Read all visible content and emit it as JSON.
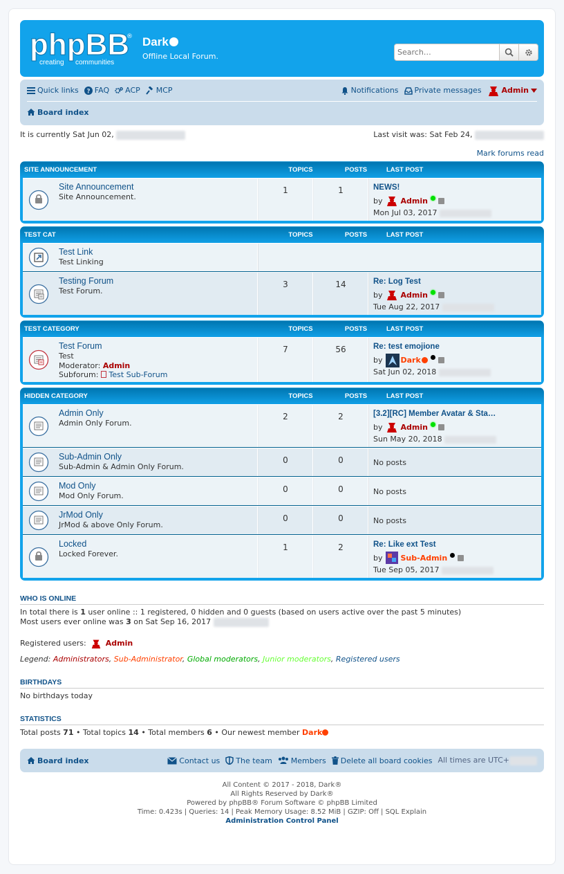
{
  "header": {
    "logo_text": "phpBB",
    "logo_sub1": "creating",
    "logo_sub2": "communities",
    "site_title": "Dark",
    "site_desc": "Offline Local Forum.",
    "search_placeholder": "Search…"
  },
  "navbar": {
    "quick_links": "Quick links",
    "faq": "FAQ",
    "acp": "ACP",
    "mcp": "MCP",
    "notifications": "Notifications",
    "private_messages": "Private messages",
    "user": "Admin",
    "board_index": "Board index"
  },
  "info": {
    "current_time": "It is currently Sat Jun 02,",
    "last_visit": "Last visit was: Sat Feb 24,",
    "mark_read": "Mark forums read"
  },
  "columns": {
    "topics": "TOPICS",
    "posts": "POSTS",
    "last_post": "LAST POST"
  },
  "categories": [
    {
      "name": "SITE ANNOUNCEMENT",
      "forums": [
        {
          "title": "Site Announcement",
          "desc": "Site Announcement.",
          "icon": "locked",
          "topics": "1",
          "posts": "1",
          "last": {
            "title": "NEWS!",
            "by": "by",
            "user": "Admin",
            "ucls": "u-admin",
            "avatar": "admin",
            "dot": "green",
            "date": "Mon Jul 03, 2017"
          }
        }
      ]
    },
    {
      "name": "TEST CAT",
      "forums": [
        {
          "title": "Test Link",
          "desc": "Test Linking",
          "icon": "link",
          "topics": "",
          "posts": "",
          "last": null,
          "nolast": true
        },
        {
          "title": "Testing Forum",
          "desc": "Test Forum.",
          "icon": "subforum",
          "topics": "3",
          "posts": "14",
          "last": {
            "title": "Re: Log Test",
            "by": "by",
            "user": "Admin",
            "ucls": "u-admin",
            "avatar": "admin",
            "dot": "green",
            "date": "Tue Aug 22, 2017"
          }
        }
      ]
    },
    {
      "name": "TEST CATEGORY",
      "forums": [
        {
          "title": "Test Forum",
          "desc": "Test",
          "icon": "unread-subforum",
          "topics": "7",
          "posts": "56",
          "moderator_label": "Moderator:",
          "moderator": "Admin",
          "subforum_label": "Subforum:",
          "subforum": "Test Sub-Forum",
          "last": {
            "title": "Re: test emojione",
            "by": "by",
            "user": "Dark",
            "ucls": "u-dark",
            "avatar": "dark",
            "dot": "black",
            "date": "Sat Jun 02, 2018"
          }
        }
      ]
    },
    {
      "name": "HIDDEN CATEGORY",
      "forums": [
        {
          "title": "Admin Only",
          "desc": "Admin Only Forum.",
          "icon": "read",
          "topics": "2",
          "posts": "2",
          "last": {
            "title": "[3.2][RC] Member Avatar & Sta…",
            "by": "by",
            "user": "Admin",
            "ucls": "u-admin",
            "avatar": "admin",
            "dot": "green",
            "date": "Sun May 20, 2018"
          }
        },
        {
          "title": "Sub-Admin Only",
          "desc": "Sub-Admin & Admin Only Forum.",
          "icon": "read",
          "topics": "0",
          "posts": "0",
          "last": null,
          "noposts": "No posts"
        },
        {
          "title": "Mod Only",
          "desc": "Mod Only Forum.",
          "icon": "read",
          "topics": "0",
          "posts": "0",
          "last": null,
          "noposts": "No posts"
        },
        {
          "title": "JrMod Only",
          "desc": "JrMod & above Only Forum.",
          "icon": "read",
          "topics": "0",
          "posts": "0",
          "last": null,
          "noposts": "No posts"
        },
        {
          "title": "Locked",
          "desc": "Locked Forever.",
          "icon": "locked",
          "topics": "1",
          "posts": "2",
          "last": {
            "title": "Re: Like ext Test",
            "by": "by",
            "user": "Sub-Admin",
            "ucls": "u-sub",
            "avatar": "sub",
            "dot": "black",
            "date": "Tue Sep 05, 2017"
          }
        }
      ]
    }
  ],
  "online": {
    "heading": "WHO IS ONLINE",
    "line1_a": "In total there is ",
    "line1_count": "1",
    "line1_b": " user online :: 1 registered, 0 hidden and 0 guests (based on users active over the past 5 minutes)",
    "line2_a": "Most users ever online was ",
    "line2_count": "3",
    "line2_b": " on Sat Sep 16, 2017",
    "registered_label": "Registered users:",
    "registered_user": "Admin",
    "legend_label": "Legend:",
    "legend": [
      "Administrators",
      "Sub-Administrator",
      "Global moderators",
      "Junior moderators",
      "Registered users"
    ]
  },
  "birthdays": {
    "heading": "BIRTHDAYS",
    "text": "No birthdays today"
  },
  "statistics": {
    "heading": "STATISTICS",
    "posts_label": "Total posts ",
    "posts": "71",
    "topics_label": " • Total topics ",
    "topics": "14",
    "members_label": " • Total members ",
    "members": "6",
    "newest_label": " • Our newest member ",
    "newest": "Dark"
  },
  "footer": {
    "board_index": "Board index",
    "contact": "Contact us",
    "team": "The team",
    "members": "Members",
    "delete_cookies": "Delete all board cookies",
    "timezone": "All times are UTC+",
    "copy1": "All Content © 2017 - 2018, Dark®",
    "copy2": "All Rights Reserved by Dark",
    "copy3": "Powered by phpBB® Forum Software © phpBB Limited",
    "copy4": "Time: 0.423s | Queries: 14 | Peak Memory Usage: 8.52 MiB | GZIP: Off | SQL Explain",
    "acp_link": "Administration Control Panel"
  },
  "colors": {
    "header": "#12a3eb",
    "navbar": "#cadceb",
    "admin": "#aa0000",
    "subadmin": "#ff4000",
    "link": "#105289"
  }
}
